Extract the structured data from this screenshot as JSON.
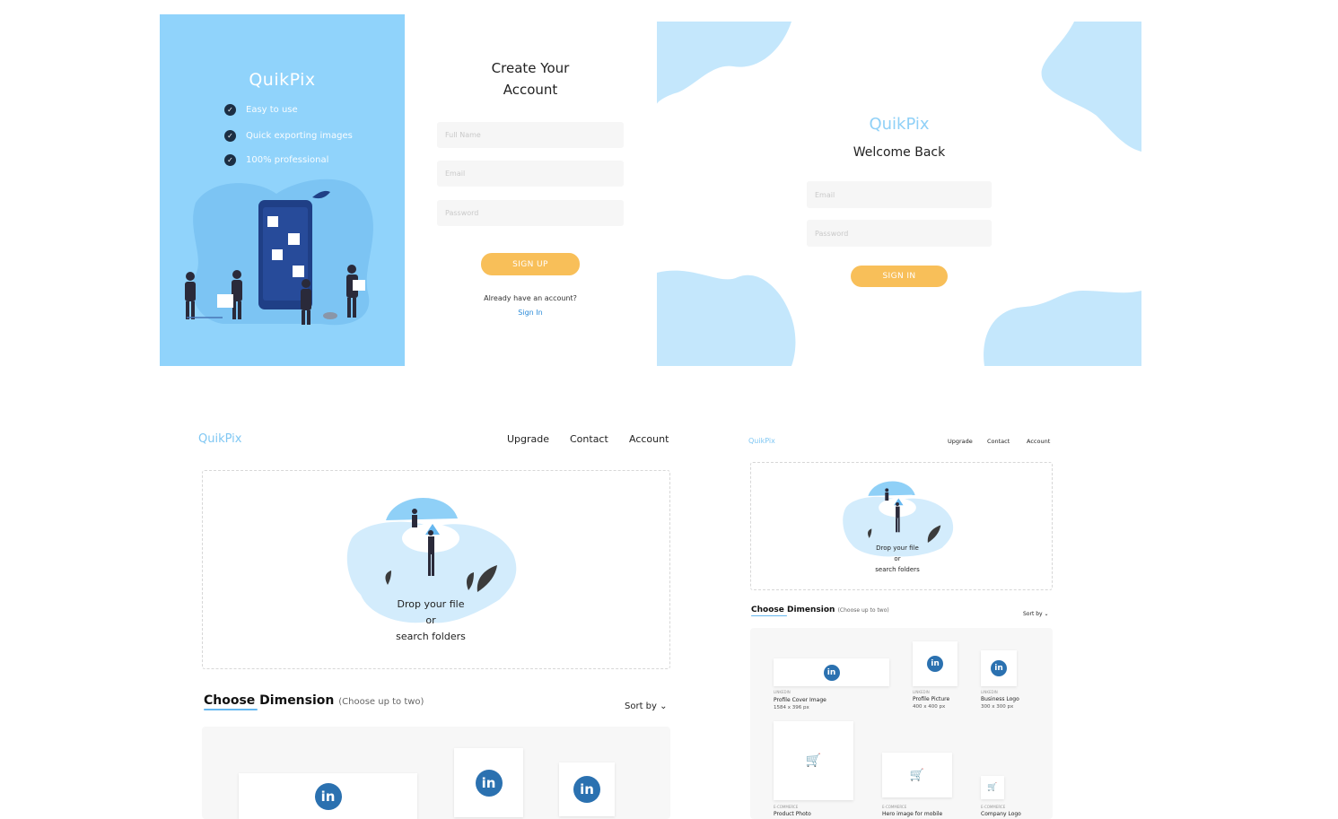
{
  "signup": {
    "brand": "QuikPix",
    "features": [
      "Easy to use",
      "Quick exporting images",
      "100% professional"
    ],
    "title_line1": "Create Your",
    "title_line2": "Account",
    "fullname_placeholder": "Full Name",
    "email_placeholder": "Email",
    "password_placeholder": "Password",
    "signup_button": "SIGN UP",
    "have_account": "Already have an account?",
    "signin_link": "Sign In"
  },
  "signin": {
    "brand": "QuikPix",
    "welcome": "Welcome Back",
    "email_placeholder": "Email",
    "password_placeholder": "Password",
    "signin_button": "SIGN IN"
  },
  "upload_large": {
    "brand": "QuikPix",
    "nav": [
      "Upgrade",
      "Contact",
      "Account"
    ],
    "drop_line1": "Drop your file",
    "drop_line2": "or",
    "drop_line3": "search folders",
    "choose_title": "Choose Dimension",
    "choose_note": "(Choose up to two)",
    "sort_by": "Sort by"
  },
  "upload_small": {
    "brand": "QuikPix",
    "nav": [
      "Upgrade",
      "Contact",
      "Account"
    ],
    "drop_line1": "Drop your file",
    "drop_line2": "or",
    "drop_line3": "search folders",
    "choose_title": "Choose Dimension",
    "choose_note": "(Choose up to two)",
    "sort_by": "Sort by",
    "cards": [
      {
        "category": "LINKEDIN",
        "name": "Profile Cover Image",
        "dims": "1584 x 396 px"
      },
      {
        "category": "LINKEDIN",
        "name": "Profile Picture",
        "dims": "400 x 400 px"
      },
      {
        "category": "LINKEDIN",
        "name": "Business Logo",
        "dims": "300 x 300 px"
      },
      {
        "category": "E-COMMERCE",
        "name": "Product Photo",
        "dims": ""
      },
      {
        "category": "E-COMMERCE",
        "name": "Hero image for mobile",
        "dims": ""
      },
      {
        "category": "E-COMMERCE",
        "name": "Company Logo",
        "dims": ""
      }
    ]
  },
  "icons": {
    "linkedin_glyph": "in",
    "check_glyph": "✓",
    "chevron_glyph": "⌄",
    "cart_glyph": "🛒"
  },
  "colors": {
    "sky_blue": "#90d3fb",
    "accent_orange": "#f8bf59",
    "linkedin_blue": "#2b71b0",
    "link_blue": "#2b8bd8"
  }
}
